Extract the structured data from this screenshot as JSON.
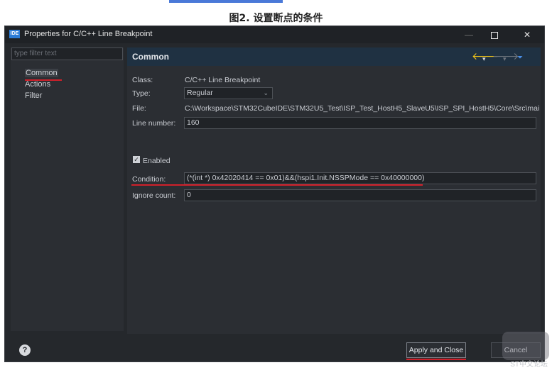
{
  "caption": "图2. 设置断点的条件",
  "window": {
    "title": "Properties for C/C++ Line Breakpoint",
    "app_icon_text": "IDE",
    "min_glyph": "—",
    "close_glyph": "✕"
  },
  "left": {
    "filter_placeholder": "type filter text",
    "tree": [
      "Common",
      "Actions",
      "Filter"
    ]
  },
  "header": {
    "title": "Common",
    "back_glyph": "🡐",
    "forward_glyph": "🡒",
    "dropdown_glyph": "▾",
    "menu_glyph": "⏷"
  },
  "form": {
    "class_label": "Class:",
    "class_value": "C/C++ Line Breakpoint",
    "type_label": "Type:",
    "type_value": "Regular",
    "file_label": "File:",
    "file_value": "C:\\Workspace\\STM32CubeIDE\\STM32U5_Test\\ISP_Test_HostH5_SlaveU5\\ISP_SPI_HostH5\\Core\\Src\\main.c",
    "line_label": "Line number:",
    "line_value": "160",
    "enabled_label": "Enabled",
    "enabled_checked": true,
    "condition_label": "Condition:",
    "condition_value": "(*(int *) 0x42020414 == 0x01)&&(hspi1.Init.NSSPMode == 0x40000000)",
    "ignore_label": "Ignore count:",
    "ignore_value": "0"
  },
  "footer": {
    "help_glyph": "?",
    "apply_label": "Apply and Close",
    "cancel_label": "Cancel"
  },
  "watermark": "ST中文论坛",
  "colors": {
    "accent_red": "#d0202a",
    "header_bg": "#1f3142",
    "window_bg": "#25282c",
    "nav_yellow": "#f0c419",
    "nav_blue": "#4a8fe8"
  }
}
